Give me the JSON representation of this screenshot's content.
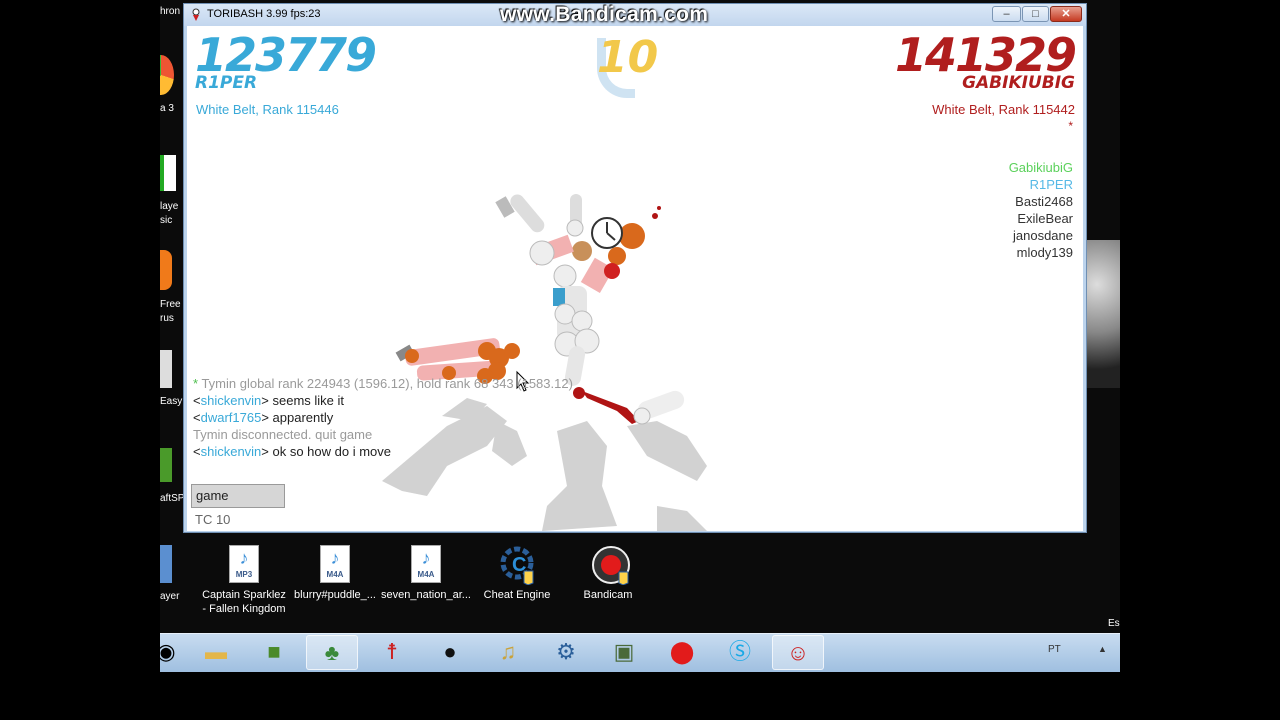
{
  "window": {
    "title": "TORIBASH 3.99 fps:23",
    "min": "–",
    "max": "□",
    "close": "✕"
  },
  "watermark": "www.Bandicam.com",
  "game": {
    "left_player": {
      "score": "123779",
      "name": "R1PER",
      "rank": "White Belt, Rank 115446"
    },
    "right_player": {
      "score": "141329",
      "name": "GABIKIUBIG",
      "rank": "White Belt, Rank 115442",
      "marker": "*"
    },
    "timer": "10",
    "players": [
      {
        "name": "GabikiubiG",
        "color": "#5bd15b"
      },
      {
        "name": "R1PER",
        "color": "#56b9e6"
      },
      {
        "name": "Basti2468",
        "color": "#333333"
      },
      {
        "name": "ExileBear",
        "color": "#333333"
      },
      {
        "name": "janosdane",
        "color": "#333333"
      },
      {
        "name": "mlody139",
        "color": "#333333"
      }
    ],
    "chat": {
      "system": {
        "bullet": "*",
        "text": " Tymin global rank 224943 (1596.12), hold rank 68 343 (1583.12)"
      },
      "msg1": {
        "open": "<",
        "user": "shickenvin",
        "close": ">",
        "text": " seems like it"
      },
      "msg2": {
        "open": "<",
        "user": "dwarf1765",
        "close": ">",
        "text": " apparently"
      },
      "notice": "Tymin disconnected. quit game",
      "msg3": {
        "open": "<",
        "user": "shickenvin",
        "close": ">",
        "text": " ok so how do i move"
      }
    },
    "input_value": "game",
    "tc": "TC 10"
  },
  "desktop": {
    "left_labels": [
      "hron",
      "a 3",
      "laye",
      "sic",
      "Free",
      "rus",
      "Easy",
      "aftSP",
      "ayer"
    ],
    "right_label": "Es",
    "icons": [
      {
        "label1": "Captain Sparklez",
        "label2": "- Fallen Kingdom",
        "tag": "MP3"
      },
      {
        "label1": "blurry#puddle_...",
        "label2": "",
        "tag": "M4A"
      },
      {
        "label1": "seven_nation_ar...",
        "label2": "",
        "tag": "M4A"
      },
      {
        "label1": "Cheat Engine",
        "label2": ""
      },
      {
        "label1": "Bandicam",
        "label2": ""
      }
    ]
  },
  "taskbar": {
    "lang": "PT",
    "up": "▲"
  }
}
